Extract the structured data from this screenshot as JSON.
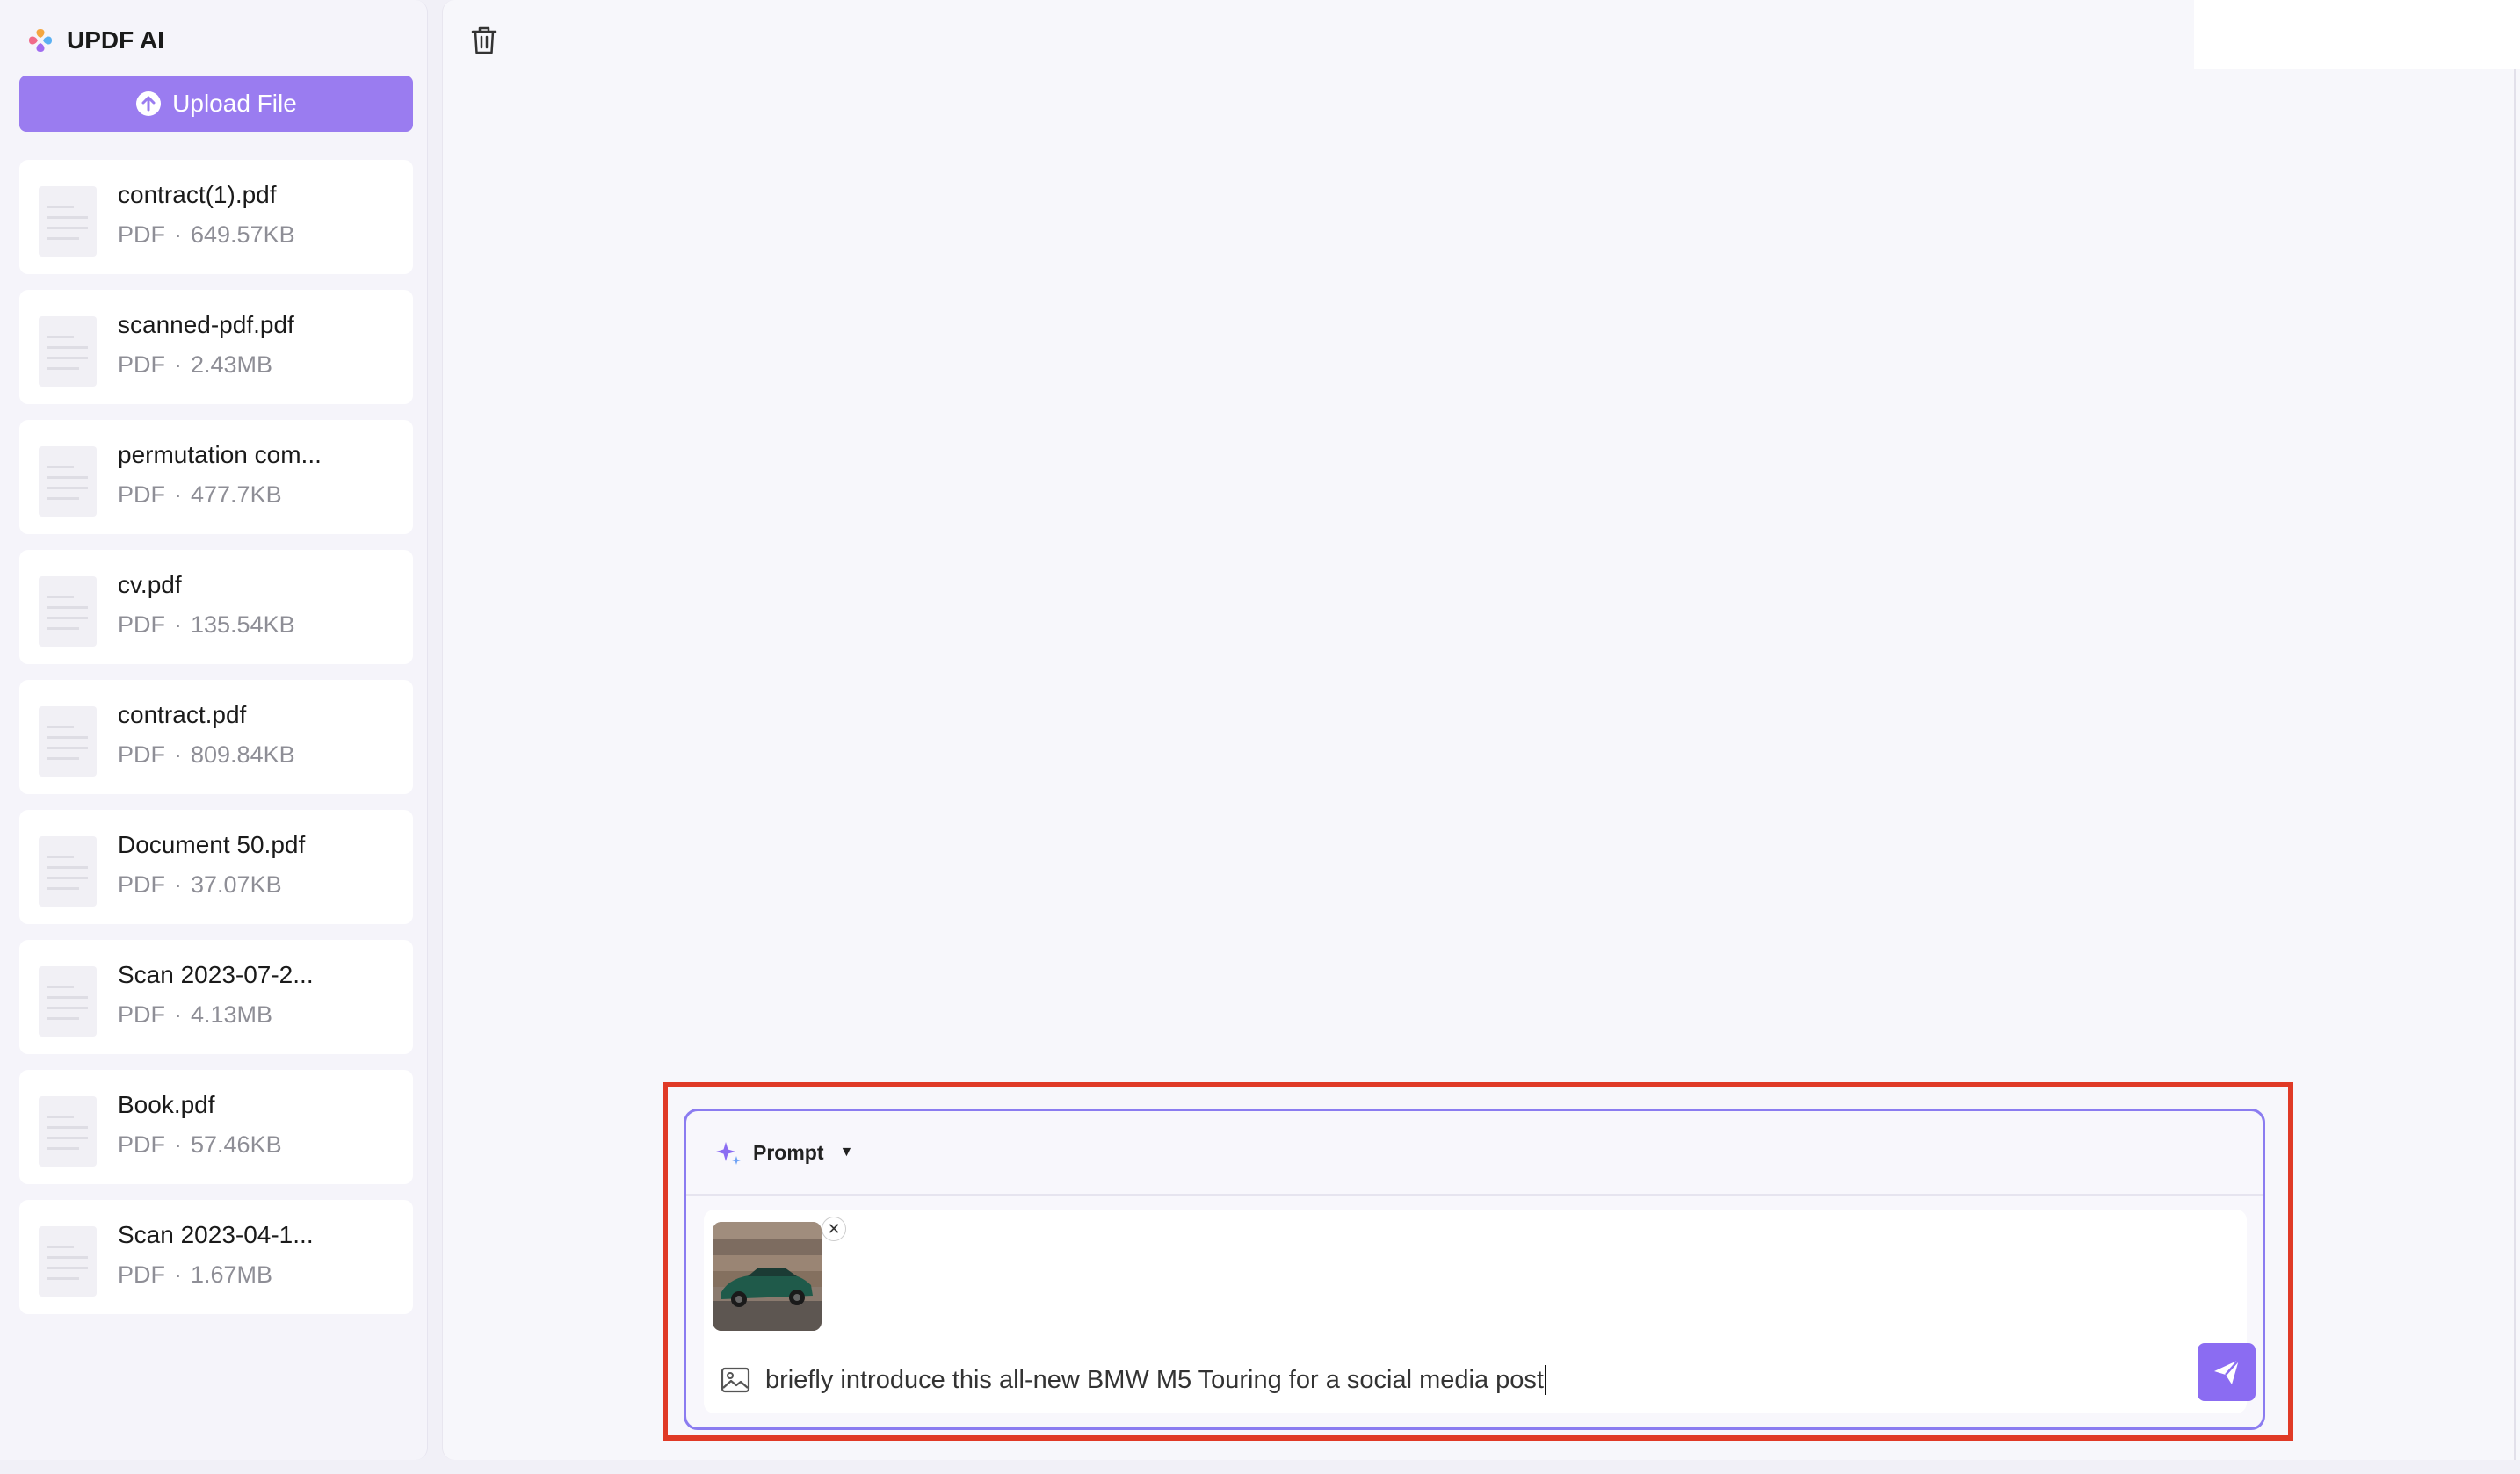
{
  "app": {
    "title": "UPDF AI"
  },
  "sidebar": {
    "upload_label": "Upload File",
    "files": [
      {
        "name": "contract(1).pdf",
        "type": "PDF",
        "size": "649.57KB"
      },
      {
        "name": "scanned-pdf.pdf",
        "type": "PDF",
        "size": "2.43MB"
      },
      {
        "name": "permutation com...",
        "type": "PDF",
        "size": "477.7KB"
      },
      {
        "name": "cv.pdf",
        "type": "PDF",
        "size": "135.54KB"
      },
      {
        "name": "contract.pdf",
        "type": "PDF",
        "size": "809.84KB"
      },
      {
        "name": "Document 50.pdf",
        "type": "PDF",
        "size": "37.07KB"
      },
      {
        "name": "Scan 2023-07-2...",
        "type": "PDF",
        "size": "4.13MB"
      },
      {
        "name": "Book.pdf",
        "type": "PDF",
        "size": "57.46KB"
      },
      {
        "name": "Scan 2023-04-1...",
        "type": "PDF",
        "size": "1.67MB"
      }
    ]
  },
  "composer": {
    "mode_label": "Prompt",
    "input_value": "briefly introduce this all-new BMW M5 Touring for a social media post",
    "attachment_icon": "car-image-thumbnail"
  },
  "colors": {
    "accent": "#8b6cf2",
    "upload_button": "#9a7cf0",
    "highlight_frame": "#e03a26"
  },
  "separator": "·"
}
